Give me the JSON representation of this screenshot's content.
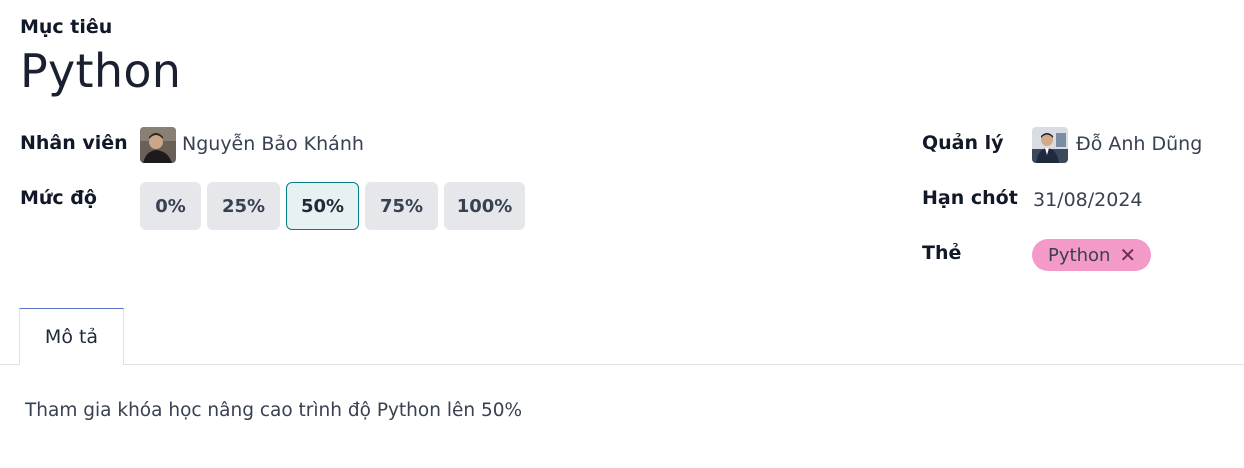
{
  "record": {
    "caption": "Mục tiêu",
    "title": "Python"
  },
  "fields": {
    "employee": {
      "label": "Nhân viên",
      "value": "Nguyễn Bảo Khánh",
      "avatar_icon": "employee-avatar"
    },
    "level": {
      "label": "Mức độ",
      "options": [
        "0%",
        "25%",
        "50%",
        "75%",
        "100%"
      ],
      "selected": "50%"
    },
    "manager": {
      "label": "Quản lý",
      "value": "Đỗ Anh Dũng",
      "avatar_icon": "manager-avatar"
    },
    "deadline": {
      "label": "Hạn chót",
      "value": "31/08/2024"
    },
    "tags": {
      "label": "Thẻ",
      "items": [
        {
          "name": "Python",
          "color": "#f49ac8",
          "remove_icon": "close-icon"
        }
      ]
    }
  },
  "tabs": [
    {
      "label": "Mô tả",
      "active": true
    }
  ],
  "description": {
    "text": "Tham gia khóa học nâng cao trình độ Python lên 50%"
  },
  "colors": {
    "accent": "#017e84",
    "active_tab_border": "#5b6ec7",
    "tag_pink": "#f49ac8"
  }
}
